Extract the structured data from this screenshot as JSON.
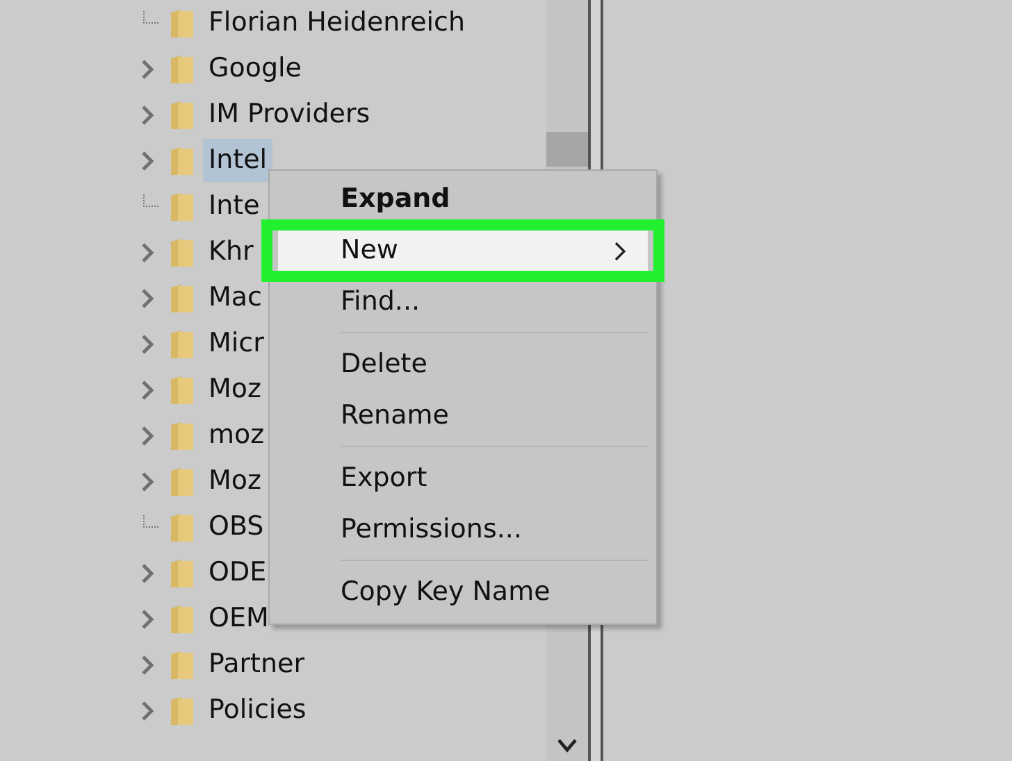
{
  "tree": {
    "items": [
      {
        "label": "Florian Heidenreich",
        "kind": "leaf",
        "selected": false
      },
      {
        "label": "Google",
        "kind": "branch",
        "selected": false
      },
      {
        "label": "IM Providers",
        "kind": "branch",
        "selected": false
      },
      {
        "label": "Intel",
        "kind": "branch",
        "selected": true
      },
      {
        "label": "Inte",
        "kind": "leaf",
        "selected": false
      },
      {
        "label": "Khr",
        "kind": "branch",
        "selected": false
      },
      {
        "label": "Mac",
        "kind": "branch",
        "selected": false
      },
      {
        "label": "Micr",
        "kind": "branch",
        "selected": false
      },
      {
        "label": "Moz",
        "kind": "branch",
        "selected": false
      },
      {
        "label": "moz",
        "kind": "branch",
        "selected": false
      },
      {
        "label": "Moz",
        "kind": "branch",
        "selected": false
      },
      {
        "label": "OBS",
        "kind": "leaf",
        "selected": false
      },
      {
        "label": "ODE",
        "kind": "branch",
        "selected": false
      },
      {
        "label": "OEM",
        "kind": "branch",
        "selected": false
      },
      {
        "label": "Partner",
        "kind": "branch",
        "selected": false
      },
      {
        "label": "Policies",
        "kind": "branch",
        "selected": false
      }
    ]
  },
  "context_menu": {
    "items": [
      {
        "kind": "item",
        "label": "Expand",
        "bold": true,
        "selected": false,
        "submenu": false,
        "outlined": false
      },
      {
        "kind": "item",
        "label": "New",
        "bold": false,
        "selected": true,
        "submenu": true,
        "outlined": true
      },
      {
        "kind": "item",
        "label": "Find...",
        "bold": false,
        "selected": false,
        "submenu": false,
        "outlined": false
      },
      {
        "kind": "separator"
      },
      {
        "kind": "item",
        "label": "Delete",
        "bold": false,
        "selected": false,
        "submenu": false,
        "outlined": false
      },
      {
        "kind": "item",
        "label": "Rename",
        "bold": false,
        "selected": false,
        "submenu": false,
        "outlined": false
      },
      {
        "kind": "separator"
      },
      {
        "kind": "item",
        "label": "Export",
        "bold": false,
        "selected": false,
        "submenu": false,
        "outlined": false
      },
      {
        "kind": "item",
        "label": "Permissions...",
        "bold": false,
        "selected": false,
        "submenu": false,
        "outlined": false
      },
      {
        "kind": "separator"
      },
      {
        "kind": "item",
        "label": "Copy Key Name",
        "bold": false,
        "selected": false,
        "submenu": false,
        "outlined": false
      }
    ]
  }
}
